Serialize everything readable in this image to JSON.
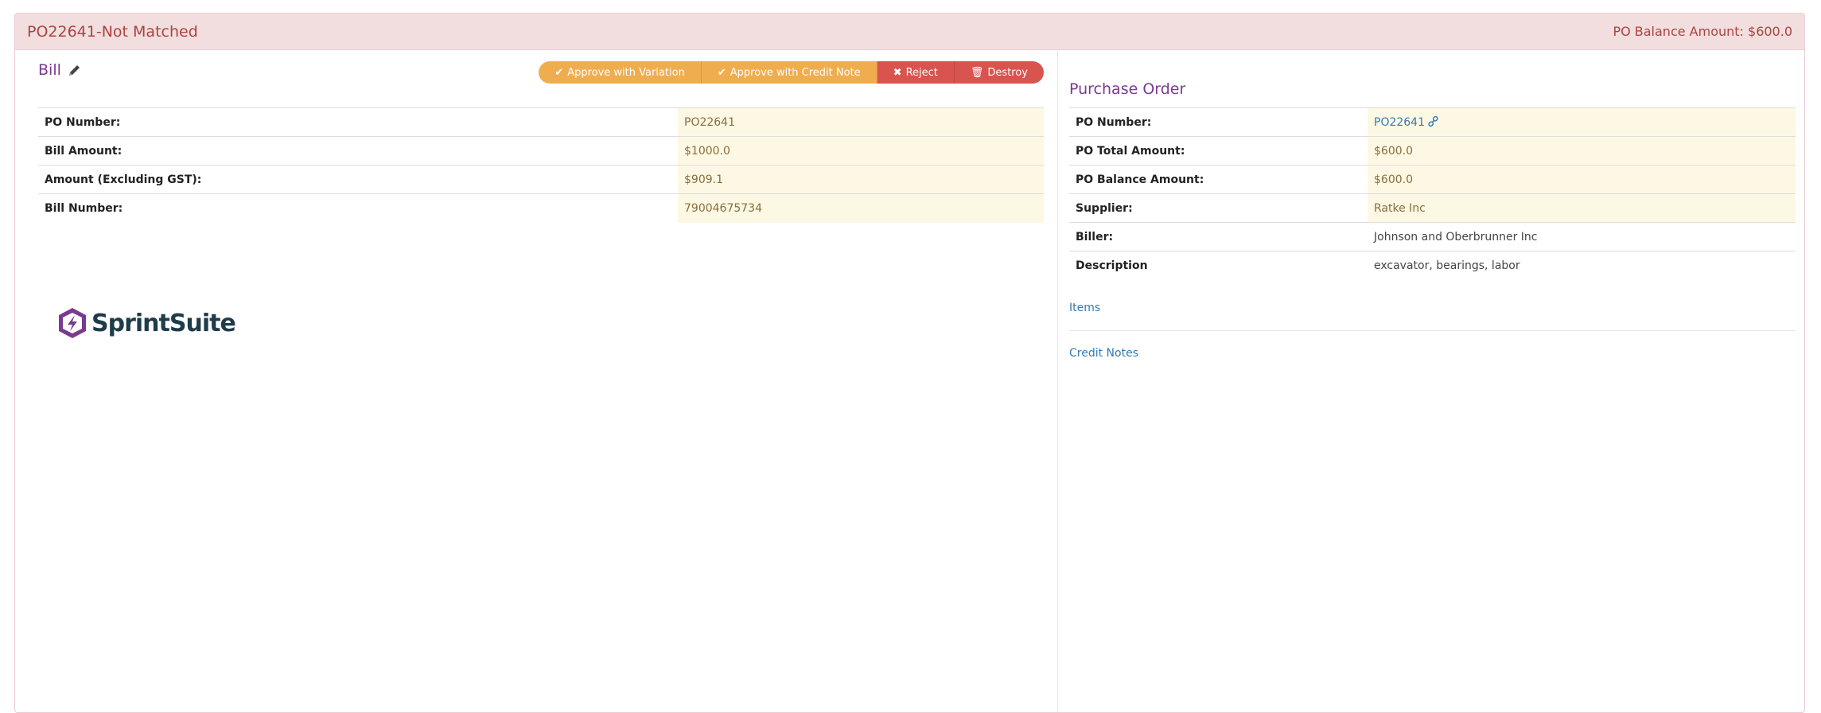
{
  "panel": {
    "title": "PO22641-Not Matched",
    "balance_label": "PO Balance Amount: $600.0"
  },
  "bill": {
    "title": "Bill",
    "buttons": {
      "approve_variation": "Approve with Variation",
      "approve_credit": "Approve with Credit Note",
      "reject": "Reject",
      "destroy": "Destroy"
    },
    "rows": [
      {
        "label": "PO Number:",
        "value": "PO22641"
      },
      {
        "label": "Bill Amount:",
        "value": "$1000.0"
      },
      {
        "label": "Amount (Excluding GST):",
        "value": "$909.1"
      },
      {
        "label": "Bill Number:",
        "value": "79004675734"
      }
    ]
  },
  "logo": {
    "text": "SprintSuite",
    "colors": {
      "hexagon": "#7b3a8f",
      "text": "#1f3c4a"
    }
  },
  "purchase_order": {
    "title": "Purchase Order",
    "rows": [
      {
        "label": "PO Number:",
        "value": "PO22641"
      },
      {
        "label": "PO Total Amount:",
        "value": "$600.0"
      },
      {
        "label": "PO Balance Amount:",
        "value": "$600.0"
      },
      {
        "label": "Supplier:",
        "value": "Ratke Inc"
      },
      {
        "label": "Biller:",
        "value": "Johnson and Oberbrunner Inc"
      },
      {
        "label": "Description",
        "value": "excavator, bearings, labor"
      }
    ],
    "links": {
      "items": "Items",
      "credit_notes": "Credit Notes"
    }
  },
  "colors": {
    "heading_bg": "#f2dede",
    "heading_text": "#a94442",
    "accent_purple": "#7b3a8f",
    "warning": "#f0ad4e",
    "danger": "#d9534f",
    "highlight_cell": "#fcf8e3",
    "link": "#337ab7"
  }
}
